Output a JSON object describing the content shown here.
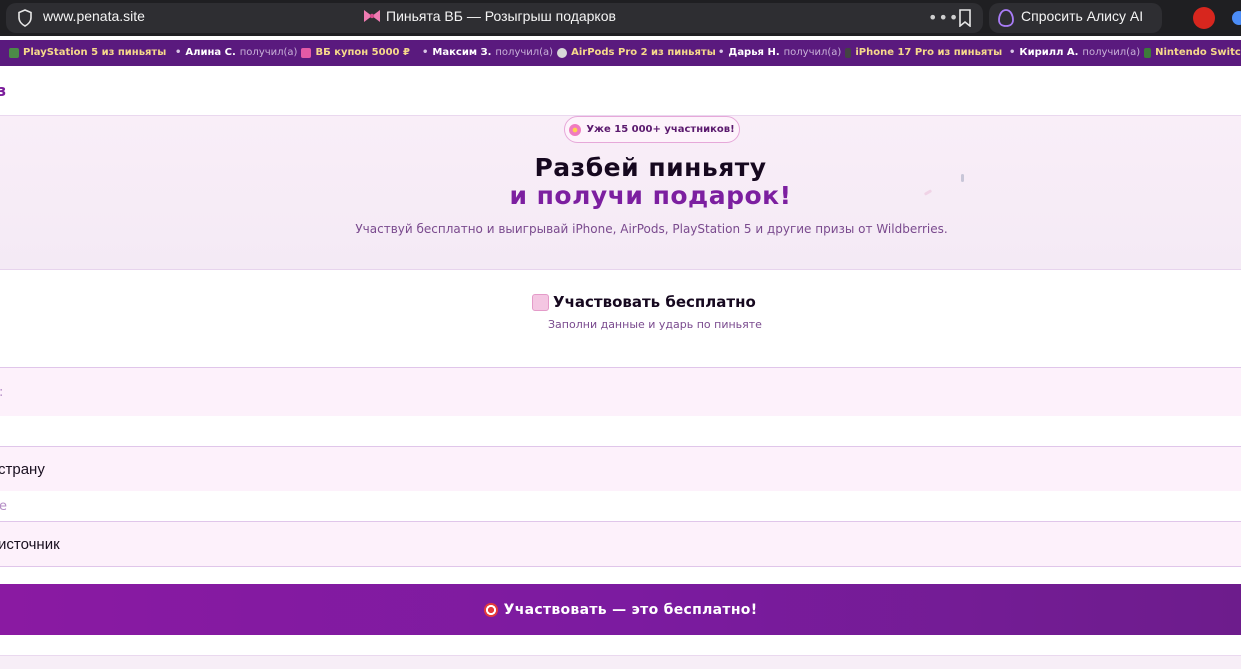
{
  "browser": {
    "url": "www.penata.site",
    "tab_title": "Пиньята ВБ — Розыгрыш подарков",
    "alice_label": "Спросить Алису AI"
  },
  "ticker": [
    {
      "name": "",
      "verb": "",
      "prize": "PlayStation 5 из пиньяты"
    },
    {
      "name": "Алина С.",
      "verb": "получил(а)",
      "prize": "ВБ купон 5000 ₽"
    },
    {
      "name": "Максим З.",
      "verb": "получил(а)",
      "prize": "AirPods Pro 2 из пиньяты"
    },
    {
      "name": "Дарья Н.",
      "verb": "получил(а)",
      "prize": "iPhone 17 Pro из пиньяты"
    },
    {
      "name": "Кирилл А.",
      "verb": "получил(а)",
      "prize": "Nintendo Switch из"
    }
  ],
  "header": {
    "logo_fragment": "з"
  },
  "hero": {
    "badge": "Уже 15 000+ участников!",
    "title_line1": "Разбей пиньяту",
    "title_line2": "и получи подарок!",
    "subtitle": "Участвуй бесплатно и выигрывай iPhone, AirPods, PlayStation 5 и другие призы от Wildberries."
  },
  "form": {
    "title": "Участвовать бесплатно",
    "subtitle": "Заполни данные и ударь по пиньяте",
    "field1_placeholder": ":",
    "field2_value": "страну",
    "label2": "е",
    "field3_value": "источник"
  },
  "cta": {
    "label": "Участвовать — это бесплатно!"
  },
  "colors": {
    "accent": "#7c1fa0",
    "ticker_bg": "#5a1a7e",
    "ticker_prize": "#f6d98b"
  }
}
